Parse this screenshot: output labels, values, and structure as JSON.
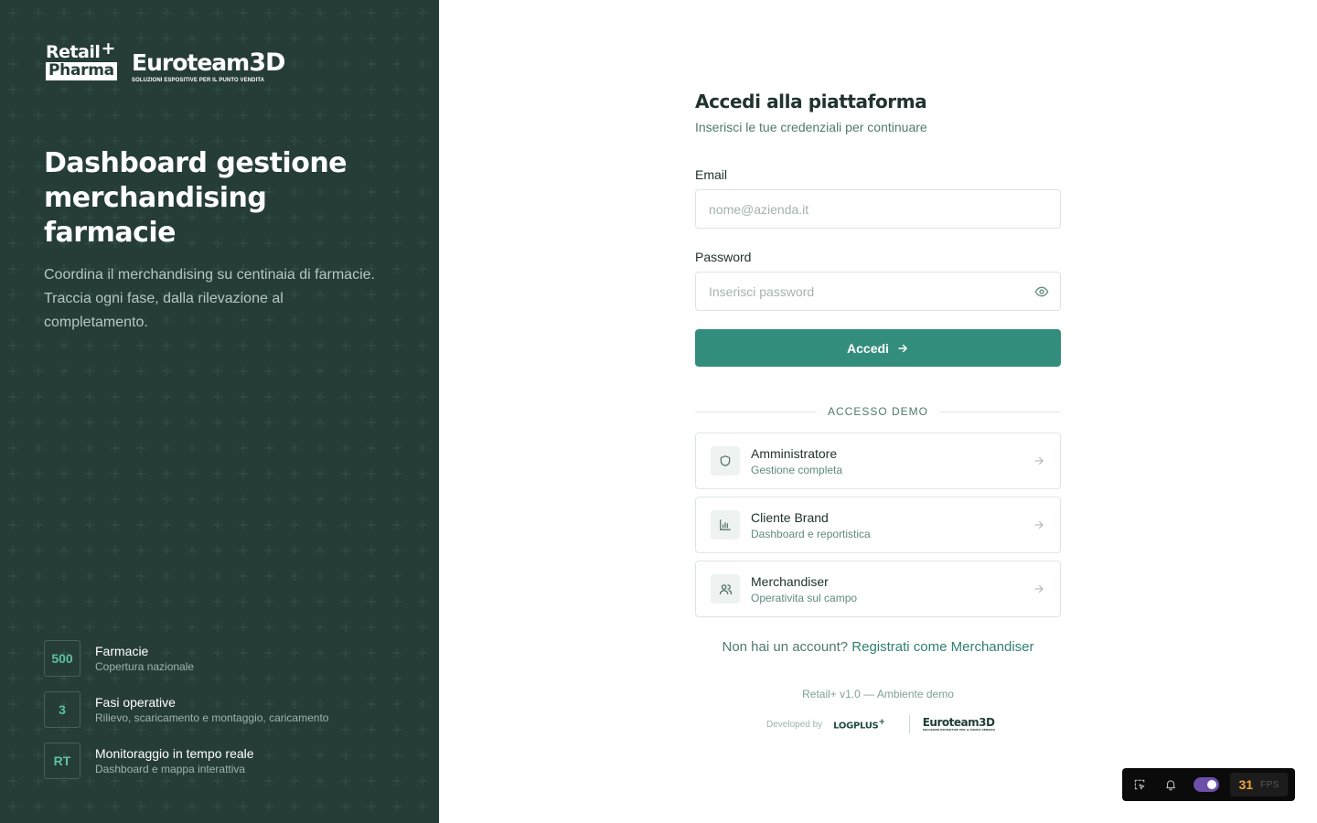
{
  "brand": {
    "retail_top": "Retail",
    "retail_plus": "+",
    "retail_bottom": "Pharma",
    "euroteam_name": "Euroteam",
    "euroteam_3d": "3D",
    "euroteam_tagline": "SOLUZIONI ESPOSITIVE PER IL PUNTO VENDITA"
  },
  "hero": {
    "title": "Dashboard gestione merchandising farmacie",
    "description": "Coordina il merchandising su centinaia di farmacie. Traccia ogni fase, dalla rilevazione al completamento."
  },
  "stats": [
    {
      "badge": "500",
      "title": "Farmacie",
      "subtitle": "Copertura nazionale"
    },
    {
      "badge": "3",
      "title": "Fasi operative",
      "subtitle": "Rilievo, scaricamento e montaggio, caricamento"
    },
    {
      "badge": "RT",
      "title": "Monitoraggio in tempo reale",
      "subtitle": "Dashboard e mappa interattiva"
    }
  ],
  "login": {
    "title": "Accedi alla piattaforma",
    "subtitle": "Inserisci le tue credenziali per continuare",
    "email_label": "Email",
    "email_placeholder": "nome@azienda.it",
    "password_label": "Password",
    "password_placeholder": "Inserisci password",
    "submit_label": "Accedi",
    "password_toggle_icon": "eye-icon",
    "submit_icon": "arrow-right-icon"
  },
  "demo": {
    "divider_label": "ACCESSO DEMO",
    "options": [
      {
        "title": "Amministratore",
        "subtitle": "Gestione completa",
        "icon": "shield-icon"
      },
      {
        "title": "Cliente Brand",
        "subtitle": "Dashboard e reportistica",
        "icon": "bar-chart-icon"
      },
      {
        "title": "Merchandiser",
        "subtitle": "Operativita sul campo",
        "icon": "users-icon"
      }
    ]
  },
  "register": {
    "prompt": "Non hai un account?",
    "link": "Registrati come Merchandiser"
  },
  "footer": {
    "version": "Retail+ v1.0 — Ambiente demo",
    "developed_by": "Developed by",
    "logplus": "LOGPLUS",
    "logplus_plus": "+",
    "euroteam_name": "Euroteam",
    "euroteam_3d": "3D",
    "euroteam_tagline": "SOLUZIONI ESPOSITIVE PER IL PUNTO VENDITA"
  },
  "devbar": {
    "fps_value": "31",
    "fps_unit": "FPS",
    "toggle_on": true
  },
  "colors": {
    "panel_bg": "#263d37",
    "accent": "#338d7d",
    "stat_badge_text": "#5fbfa6",
    "toggle": "#6b4fa8",
    "fps": "#f2a33a"
  }
}
